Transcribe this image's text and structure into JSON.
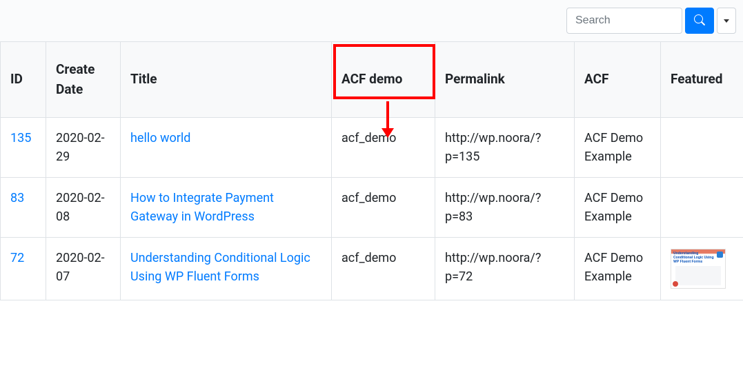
{
  "toolbar": {
    "search_placeholder": "Search"
  },
  "columns": {
    "id": "ID",
    "create_date": "Create Date",
    "title": "Title",
    "acf_demo": "ACF demo",
    "permalink": "Permalink",
    "acf": "ACF",
    "featured": "Featured"
  },
  "rows": [
    {
      "id": "135",
      "create_date": "2020-02-29",
      "title": "hello world",
      "acf_demo": "acf_demo",
      "permalink": "http://wp.noora/?p=135",
      "acf": "ACF Demo Example",
      "featured_thumb": false
    },
    {
      "id": "83",
      "create_date": "2020-02-08",
      "title": "How to Integrate Payment Gateway in WordPress",
      "acf_demo": "acf_demo",
      "permalink": "http://wp.noora/?p=83",
      "acf": "ACF Demo Example",
      "featured_thumb": false
    },
    {
      "id": "72",
      "create_date": "2020-02-07",
      "title": "Understanding Conditional Logic Using WP Fluent Forms",
      "acf_demo": "acf_demo",
      "permalink": "http://wp.noora/?p=72",
      "acf": "ACF Demo Example",
      "featured_thumb": true,
      "thumb_text": "Understanding Conditional Logic Using WP Fluent Forms"
    }
  ]
}
